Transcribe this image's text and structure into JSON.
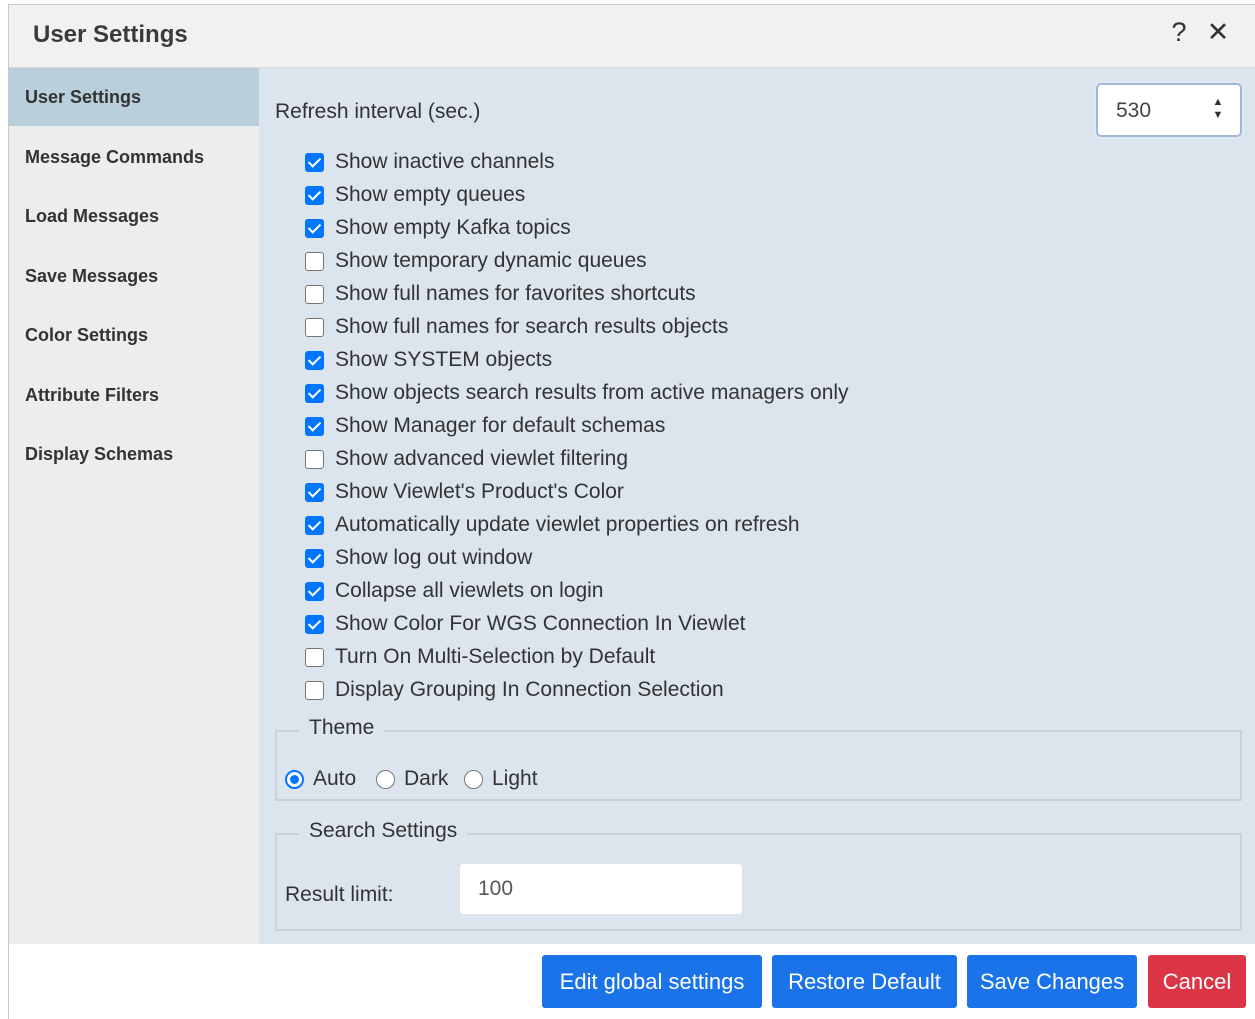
{
  "dialog": {
    "title": "User Settings"
  },
  "titlebar": {
    "help_icon": "question-mark-icon",
    "close_icon": "close-icon",
    "help": "?",
    "close": "✕"
  },
  "sidebar": {
    "items": [
      {
        "label": "User Settings",
        "active": true
      },
      {
        "label": "Message Commands"
      },
      {
        "label": "Load Messages"
      },
      {
        "label": "Save Messages"
      },
      {
        "label": "Color Settings"
      },
      {
        "label": "Attribute Filters"
      },
      {
        "label": "Display Schemas"
      }
    ]
  },
  "refresh": {
    "label": "Refresh interval (sec.)",
    "value": "530"
  },
  "options": [
    {
      "label": "Show inactive channels",
      "checked": true
    },
    {
      "label": "Show empty queues",
      "checked": true
    },
    {
      "label": "Show empty Kafka topics",
      "checked": true
    },
    {
      "label": "Show temporary dynamic queues",
      "checked": false
    },
    {
      "label": "Show full names for favorites shortcuts",
      "checked": false
    },
    {
      "label": "Show full names for search results objects",
      "checked": false
    },
    {
      "label": "Show SYSTEM objects",
      "checked": true
    },
    {
      "label": "Show objects search results from active managers only",
      "checked": true
    },
    {
      "label": "Show Manager for default schemas",
      "checked": true
    },
    {
      "label": "Show advanced viewlet filtering",
      "checked": false
    },
    {
      "label": "Show Viewlet's Product's Color",
      "checked": true
    },
    {
      "label": "Automatically update viewlet properties on refresh",
      "checked": true
    },
    {
      "label": "Show log out window",
      "checked": true
    },
    {
      "label": "Collapse all viewlets on login",
      "checked": true
    },
    {
      "label": "Show Color For WGS Connection In Viewlet",
      "checked": true
    },
    {
      "label": "Turn On Multi-Selection by Default",
      "checked": false
    },
    {
      "label": "Display Grouping In Connection Selection",
      "checked": false
    }
  ],
  "theme": {
    "legend": "Theme",
    "options": [
      {
        "label": "Auto",
        "checked": true
      },
      {
        "label": "Dark",
        "checked": false
      },
      {
        "label": "Light",
        "checked": false
      }
    ]
  },
  "search": {
    "legend": "Search Settings",
    "result_label": "Result limit:",
    "result_value": "100"
  },
  "footer": {
    "edit_global": "Edit global settings",
    "restore": "Restore Default",
    "save": "Save Changes",
    "cancel": "Cancel"
  },
  "colors": {
    "primary": "#1a73e8",
    "danger": "#dc3545",
    "active_nav": "#b9cfdb",
    "panel": "#dce4ee"
  }
}
